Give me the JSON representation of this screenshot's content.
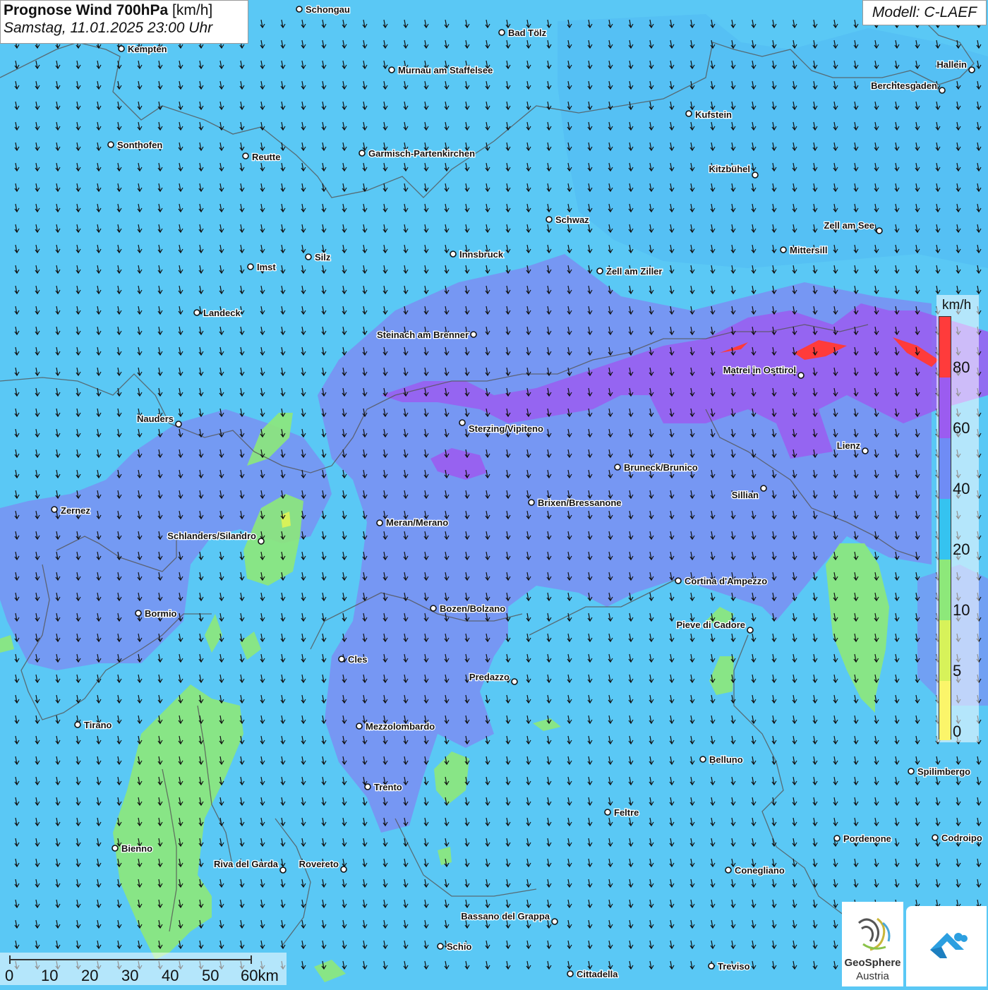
{
  "header": {
    "title_bold": "Prognose Wind 700hPa",
    "title_unit": "[km/h]",
    "datetime": "Samstag, 11.01.2025 23:00 Uhr",
    "model": "Modell: C-LAEF"
  },
  "legend": {
    "unit": "km/h",
    "ticks": [
      "80",
      "60",
      "40",
      "20",
      "10",
      "5",
      "0"
    ],
    "colors": [
      "#ff3b3b",
      "#9b5cf0",
      "#6f8cf5",
      "#35c3f0",
      "#8de87a",
      "#d7f25a",
      "#fbf56a"
    ]
  },
  "scalebar": {
    "labels": [
      "0",
      "10",
      "20",
      "30",
      "40",
      "50",
      "60km"
    ]
  },
  "branding": {
    "line1": "GeoSphere",
    "line2": "Austria"
  },
  "cities": [
    {
      "name": "Schongau"
    },
    {
      "name": "Bad Tölz"
    },
    {
      "name": "Kempten"
    },
    {
      "name": "Murnau am Staffelsee"
    },
    {
      "name": "Hallein"
    },
    {
      "name": "Berchtesgaden"
    },
    {
      "name": "Kufstein"
    },
    {
      "name": "Sonthofen"
    },
    {
      "name": "Reutte"
    },
    {
      "name": "Garmisch-Partenkirchen"
    },
    {
      "name": "Kitzbühel"
    },
    {
      "name": "Schwaz"
    },
    {
      "name": "Zell am See"
    },
    {
      "name": "Mittersill"
    },
    {
      "name": "Innsbruck"
    },
    {
      "name": "Silz"
    },
    {
      "name": "Imst"
    },
    {
      "name": "Zell am Ziller"
    },
    {
      "name": "Landeck"
    },
    {
      "name": "Steinach am Brenner"
    },
    {
      "name": "Matrei in Osttirol"
    },
    {
      "name": "Nauders"
    },
    {
      "name": "Sterzing/Vipiteno"
    },
    {
      "name": "Lienz"
    },
    {
      "name": "Bruneck/Brunico"
    },
    {
      "name": "Sillian"
    },
    {
      "name": "Zernez"
    },
    {
      "name": "Brixen/Bressanone"
    },
    {
      "name": "Meran/Merano"
    },
    {
      "name": "Schlanders/Silandro"
    },
    {
      "name": "Cortina d'Ampezzo"
    },
    {
      "name": "Bozen/Bolzano"
    },
    {
      "name": "Bormio"
    },
    {
      "name": "Pieve di Cadore"
    },
    {
      "name": "Cles"
    },
    {
      "name": "Predazzo"
    },
    {
      "name": "Tirano"
    },
    {
      "name": "Mezzolombardo"
    },
    {
      "name": "Belluno"
    },
    {
      "name": "Spilimbergo"
    },
    {
      "name": "Trento"
    },
    {
      "name": "Feltre"
    },
    {
      "name": "Pordenone"
    },
    {
      "name": "Codroipo"
    },
    {
      "name": "Bienno"
    },
    {
      "name": "Riva del Garda"
    },
    {
      "name": "Rovereto"
    },
    {
      "name": "Conegliano"
    },
    {
      "name": "Bassano del Grappa"
    },
    {
      "name": "Schio"
    },
    {
      "name": "Treviso"
    },
    {
      "name": "Cittadella"
    }
  ]
}
